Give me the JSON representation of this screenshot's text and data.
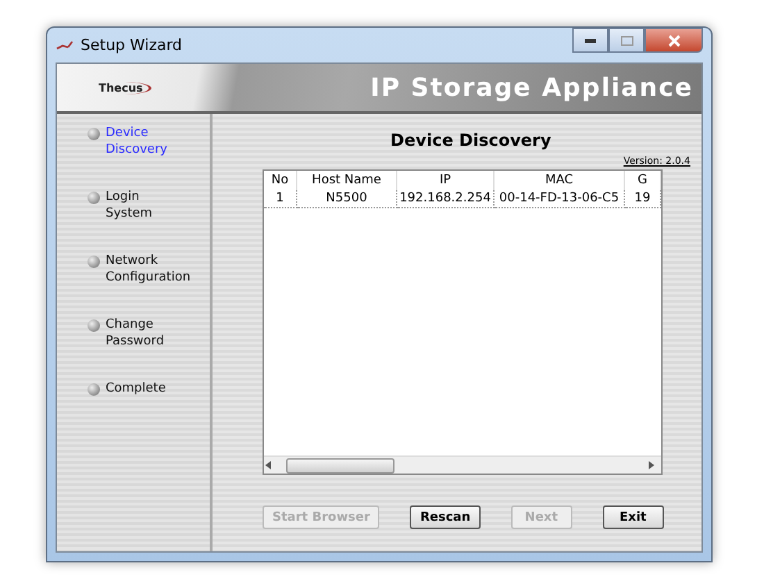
{
  "window": {
    "title": "Setup Wizard"
  },
  "banner": {
    "logo": "Thecus",
    "product": "IP Storage Appliance"
  },
  "steps": [
    {
      "label": "Device Discovery",
      "selected": true
    },
    {
      "label": "Login System",
      "selected": false
    },
    {
      "label": "Network Configuration",
      "selected": false
    },
    {
      "label": "Change Password",
      "selected": false
    },
    {
      "label": "Complete",
      "selected": false
    }
  ],
  "page": {
    "heading": "Device Discovery",
    "version": "Version: 2.0.4"
  },
  "table": {
    "columns": [
      "No",
      "Host Name",
      "IP",
      "MAC",
      "G"
    ],
    "rows": [
      [
        "1",
        "N5500",
        "192.168.2.254",
        "00-14-FD-13-06-C5",
        "19"
      ]
    ]
  },
  "buttons": [
    {
      "label": "Start Browser",
      "disabled": true
    },
    {
      "label": "Rescan",
      "disabled": false
    },
    {
      "label": "Next",
      "disabled": true
    },
    {
      "label": "Exit",
      "disabled": false
    }
  ]
}
